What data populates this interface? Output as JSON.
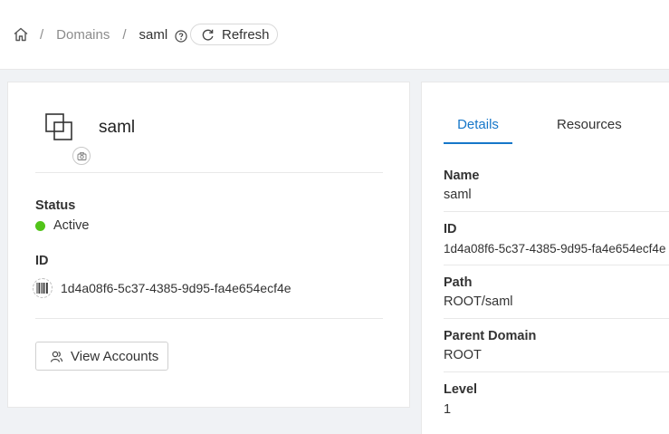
{
  "breadcrumb": {
    "separator": "/",
    "domains_link": "Domains",
    "current": "saml"
  },
  "toolbar": {
    "refresh_label": "Refresh"
  },
  "domain_card": {
    "name": "saml",
    "status_label": "Status",
    "status_value": "Active",
    "status_color": "#52c41a",
    "id_label": "ID",
    "id_value": "1d4a08f6-5c37-4385-9d95-fa4e654ecf4e",
    "view_accounts_label": "View Accounts"
  },
  "details_panel": {
    "tabs": [
      "Details",
      "Resources"
    ],
    "active_tab": "Details",
    "accent_color": "#1677c9",
    "fields": [
      {
        "label": "Name",
        "value": "saml"
      },
      {
        "label": "ID",
        "value": "1d4a08f6-5c37-4385-9d95-fa4e654ecf4e"
      },
      {
        "label": "Path",
        "value": "ROOT/saml"
      },
      {
        "label": "Parent Domain",
        "value": "ROOT"
      },
      {
        "label": "Level",
        "value": "1"
      }
    ]
  },
  "icons": [
    "home-icon",
    "help-icon",
    "refresh-icon",
    "domain-icon",
    "camera-icon",
    "barcode-icon",
    "team-icon"
  ]
}
